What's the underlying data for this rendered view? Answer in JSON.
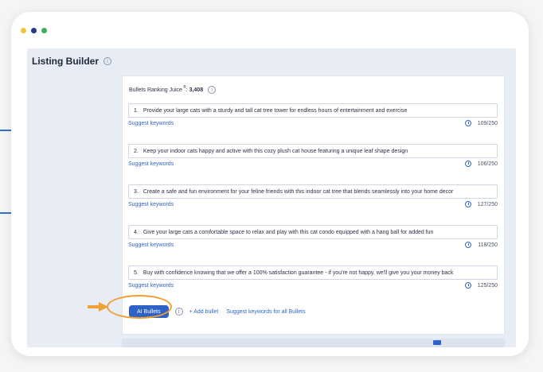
{
  "colors": {
    "dot_yellow": "#f3c33b",
    "dot_navy": "#1e3a8a",
    "dot_green": "#3fae5a",
    "accent": "#2e62c7",
    "highlight": "#f0a034"
  },
  "app": {
    "title": "Listing Builder",
    "info_glyph": "i"
  },
  "panel": {
    "heading_label": "Bullets Ranking Juice",
    "heading_sup": "®",
    "heading_colon": ":",
    "heading_value": "3,408"
  },
  "bullets": [
    {
      "num": "1.",
      "text": "Provide your large cats with a sturdy and tall cat tree tower for endless hours of entertainment and exercise",
      "suggest": "Suggest keywords",
      "count": "109/250"
    },
    {
      "num": "2.",
      "text": "Keep your indoor cats happy and active with this cozy plush cat house featuring a unique leaf shape design",
      "suggest": "Suggest keywords",
      "count": "106/250"
    },
    {
      "num": "3.",
      "text": "Create a safe and fun environment for your feline friends with this indoor cat tree that blends seamlessly into your home decor",
      "suggest": "Suggest keywords",
      "count": "127/250"
    },
    {
      "num": "4.",
      "text": "Give your large cats a comfortable space to relax and play with this cat condo equipped with a hang ball for added fun",
      "suggest": "Suggest keywords",
      "count": "118/250"
    },
    {
      "num": "5.",
      "text": "Buy with confidence knowing that we offer a 100% satisfaction guarantee - if you're not happy, we'll give you your money back",
      "suggest": "Suggest keywords",
      "count": "125/250"
    }
  ],
  "actions": {
    "ai_bullets": "AI Bullets",
    "add_bullet": "+ Add bullet",
    "suggest_all": "Suggest keywords for all Bullets"
  }
}
